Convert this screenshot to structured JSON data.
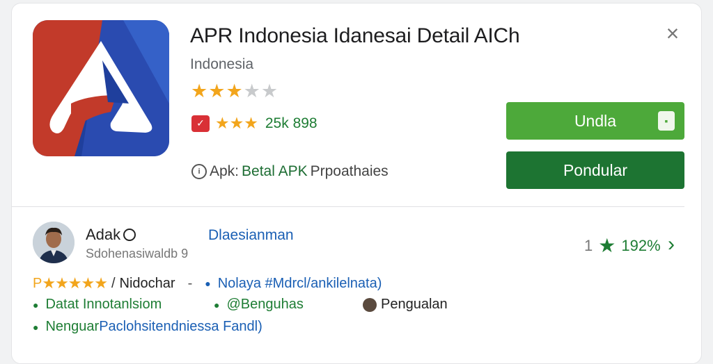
{
  "app": {
    "title": "APR Indonesia Idanesai Detail AICh",
    "developer": "Indonesia",
    "rating_stars": 3,
    "rating_max": 5,
    "meta_badge": "✓",
    "meta_stars": 3,
    "downloads": "25k 898",
    "info_prefix": "Apk:",
    "info_link": "Betal APK",
    "info_suffix": "Prpoathaies",
    "icon_name": "app-logo-icon"
  },
  "actions": {
    "close_label": "×",
    "install_label": "Undla",
    "download_label": "Pondular"
  },
  "review": {
    "name": "Adak",
    "handle": "Sdohenasiwaldb 9",
    "badge": "Dlaesianman",
    "score_num": "1",
    "score_pct": "192%",
    "rating_prefix": "P",
    "rating_stars": "★★★★★",
    "rating_sep": "/",
    "rating_label": "Nidochar",
    "rating_dash": "-",
    "rating_tag": "Nolaya #Mdrcl/ankilelnata)",
    "bullet1": "Datat Innotanlsiom",
    "bullet2": "@Benguhas",
    "bullet3": "Pengualan",
    "bullet4": "Nenguar Paclohsitendniessa Fandl)"
  },
  "colors": {
    "install_green": "#4da93a",
    "download_green": "#1d7432",
    "star_gold": "#f2a51c",
    "link_blue": "#1a5fb4"
  }
}
